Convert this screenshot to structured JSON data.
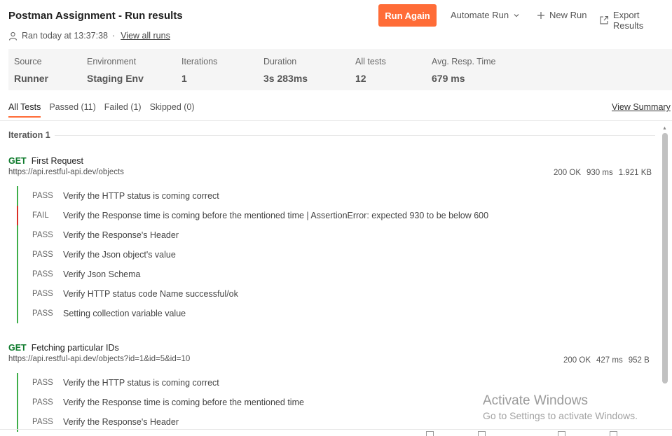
{
  "header": {
    "title": "Postman Assignment - Run results",
    "ran_text": "Ran today at 13:37:38",
    "separator": "·",
    "view_all_runs": "View all runs",
    "run_again": "Run Again",
    "automate_run": "Automate Run",
    "new_run": "New Run",
    "export_results": "Export Results"
  },
  "summary": [
    {
      "label": "Source",
      "value": "Runner"
    },
    {
      "label": "Environment",
      "value": "Staging Env"
    },
    {
      "label": "Iterations",
      "value": "1"
    },
    {
      "label": "Duration",
      "value": "3s 283ms"
    },
    {
      "label": "All tests",
      "value": "12"
    },
    {
      "label": "Avg. Resp. Time",
      "value": "679 ms"
    }
  ],
  "tabs": [
    "All Tests",
    "Passed (11)",
    "Failed (1)",
    "Skipped (0)"
  ],
  "view_summary": "View Summary",
  "iteration_label": "Iteration 1",
  "requests": [
    {
      "method": "GET",
      "name": "First Request",
      "url": "https://api.restful-api.dev/objects",
      "status": "200 OK",
      "time": "930 ms",
      "size": "1.921 KB",
      "tests": [
        {
          "status": "PASS",
          "name": "Verify the HTTP status is coming correct"
        },
        {
          "status": "FAIL",
          "name": "Verify the Response time is coming before the mentioned time | AssertionError: expected 930 to be below 600"
        },
        {
          "status": "PASS",
          "name": "Verify the Response's Header"
        },
        {
          "status": "PASS",
          "name": "Verify the Json object's value"
        },
        {
          "status": "PASS",
          "name": "Verify Json Schema"
        },
        {
          "status": "PASS",
          "name": "Verify HTTP status code Name successful/ok"
        },
        {
          "status": "PASS",
          "name": "Setting collection variable value"
        }
      ]
    },
    {
      "method": "GET",
      "name": "Fetching particular IDs",
      "url": "https://api.restful-api.dev/objects?id=1&id=5&id=10",
      "status": "200 OK",
      "time": "427 ms",
      "size": "952 B",
      "tests": [
        {
          "status": "PASS",
          "name": "Verify the HTTP status is coming correct"
        },
        {
          "status": "PASS",
          "name": "Verify the Response time is coming before the mentioned time"
        },
        {
          "status": "PASS",
          "name": "Verify the Response's Header"
        }
      ]
    }
  ],
  "watermark": {
    "line1": "Activate Windows",
    "line2": "Go to Settings to activate Windows."
  },
  "colors": {
    "accent": "#ff6c37",
    "get_method": "#0f7b2d",
    "pass_bar": "#3fae4a",
    "fail_bar": "#d93025"
  }
}
